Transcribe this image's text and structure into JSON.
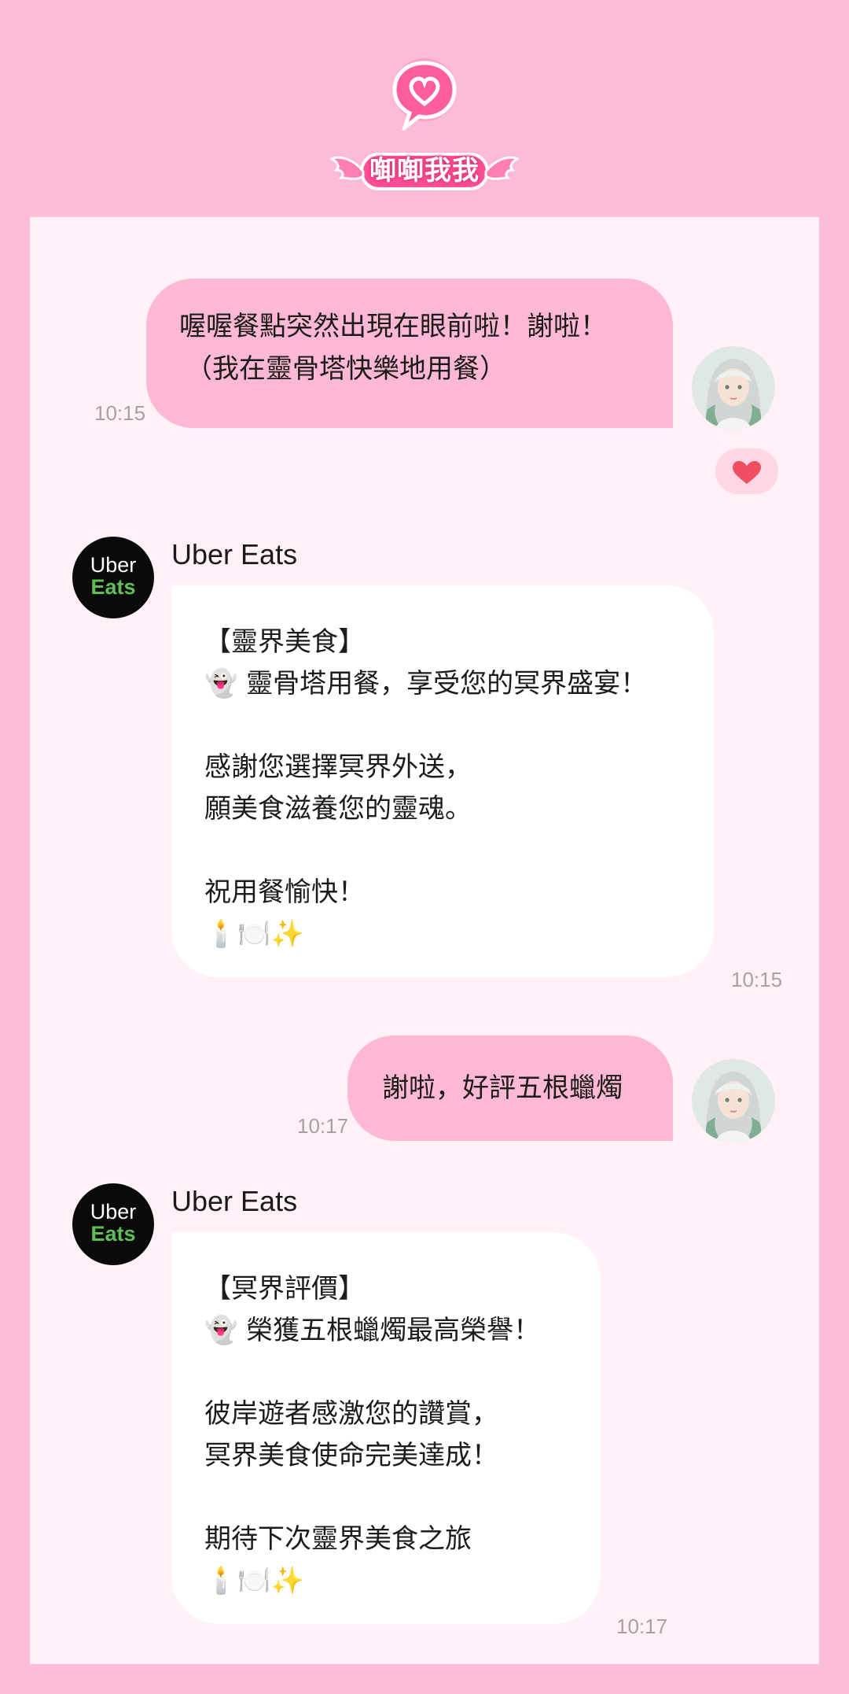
{
  "app": {
    "logo_text": "啣啣我我",
    "colors": {
      "accent": "#fdb9d3",
      "background": "#fff1f6",
      "frame": "#fdbdd6",
      "heart": "#ef4d60"
    }
  },
  "messages": [
    {
      "id": "m1",
      "direction": "outgoing",
      "lines": [
        "喔喔餐點突然出現在眼前啦！謝啦！",
        "（我在靈骨塔快樂地用餐）"
      ],
      "time": "10:15",
      "reaction": "heart-icon"
    },
    {
      "id": "m2",
      "direction": "incoming",
      "sender": "Uber Eats",
      "avatar": {
        "line1": "Uber",
        "line2": "Eats"
      },
      "text": "【靈界美食】\n👻 靈骨塔用餐，享受您的冥界盛宴！\n\n感謝您選擇冥界外送，\n願美食滋養您的靈魂。\n\n祝用餐愉快！\n🕯️🍽️✨",
      "time": "10:15"
    },
    {
      "id": "m3",
      "direction": "outgoing",
      "lines": [
        "謝啦，好評五根蠟燭"
      ],
      "time": "10:17"
    },
    {
      "id": "m4",
      "direction": "incoming",
      "sender": "Uber Eats",
      "avatar": {
        "line1": "Uber",
        "line2": "Eats"
      },
      "text": "【冥界評價】\n👻 榮獲五根蠟燭最高榮譽！\n\n彼岸遊者感激您的讚賞，\n冥界美食使命完美達成！\n\n期待下次靈界美食之旅\n🕯️🍽️✨",
      "time": "10:17"
    }
  ]
}
